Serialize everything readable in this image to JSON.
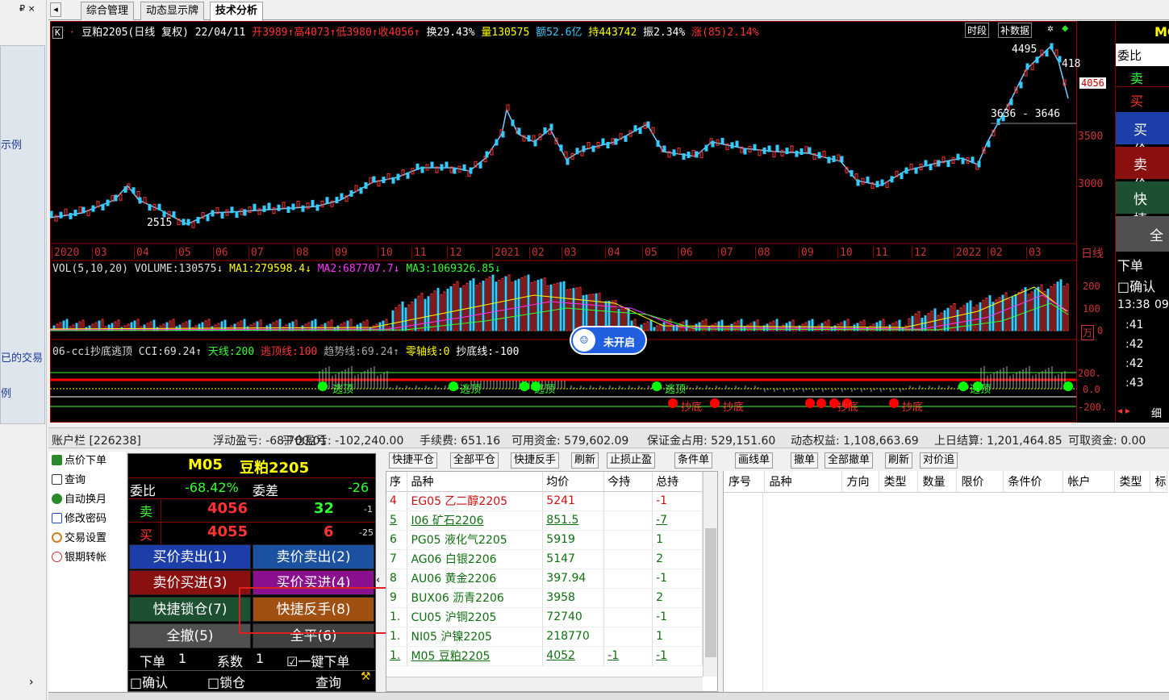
{
  "left_strip": {
    "pin": "₽ ×",
    "links": [
      "示例",
      "已的交易",
      "例"
    ]
  },
  "tabs": [
    "综合管理",
    "动态显示牌",
    "技术分析"
  ],
  "chart": {
    "header": {
      "k_icon": "K",
      "dot": "·",
      "name": "豆粕2205(日线 复权)",
      "date": "22/04/11",
      "open": "开3989↑",
      "high": "高4073↑",
      "low": "低3980↑",
      "close": "收4056↑",
      "turnover": "换29.43%",
      "volume": "量130575",
      "amount": "额52.6亿",
      "oi": "持443742",
      "amp": "振2.34%",
      "chg": "涨(85)2.14%",
      "btn_period": "时段",
      "btn_fill": "补数据"
    },
    "price_labels": {
      "high": "4495",
      "low": "2515",
      "range": "3636 - 3646",
      "partial": "418",
      "current": "4056",
      "axis": [
        "3500",
        "3000"
      ]
    },
    "date_axis": [
      "2020",
      "03",
      "04",
      "05",
      "06",
      "07",
      "08",
      "09",
      "10",
      "11",
      "12",
      "2021",
      "02",
      "03",
      "04",
      "05",
      "06",
      "07",
      "08",
      "09",
      "10",
      "11",
      "12",
      "2022",
      "02",
      "03"
    ],
    "period": "日线",
    "vol": {
      "name": "VOL(5,10,20)",
      "v": "VOLUME:130575↓",
      "ma1": "MA1:279598.4↓",
      "ma2": "MA2:687707.7↓",
      "ma3": "MA3:1069326.85↓",
      "axis": [
        "200",
        "100",
        "0"
      ],
      "unit": "万"
    },
    "cci": {
      "name": "06-cci抄底逃顶",
      "cci": "CCI:69.24↑",
      "sky": "天线:200",
      "top": "逃顶线:100",
      "trend": "趋势线:69.24↑",
      "zero": "零轴线:0",
      "bottom": "抄底线:-100",
      "axis": [
        "200.",
        "0.0",
        "-200."
      ]
    },
    "bottom_labels": [
      "抄底",
      "抄底",
      "抄底",
      "抄底"
    ],
    "top_labels": [
      "逃顶",
      "逃顶",
      "逃顶",
      "逃顶",
      "逃顶"
    ],
    "badge": "未开启"
  },
  "right_panel": {
    "title": "MC",
    "weibi": "委比",
    "sell": "卖",
    "buy": "买",
    "btns": [
      "买价",
      "卖价",
      "快捷",
      "全"
    ],
    "xiadan": "下单",
    "confirm": "□确认",
    "times": [
      "13:38",
      "09",
      ":41",
      ":42",
      ":42",
      ":43"
    ],
    "fine": "细"
  },
  "account": {
    "acct": "账户栏 [226238]",
    "float_pl": "浮动盈亏: -68,700.01",
    "close_pl": "平仓盈亏: -102,240.00",
    "fee": "手续费: 651.16",
    "avail": "可用资金: 579,602.09",
    "margin": "保证金占用: 529,151.60",
    "equity": "动态权益: 1,108,663.69",
    "settle": "上日结算: 1,201,464.85",
    "withdraw": "可取资金: 0.00"
  },
  "menu": [
    "点价下单",
    "查询",
    "自动换月",
    "修改密码",
    "交易设置",
    "银期转帐"
  ],
  "order": {
    "code": "M05",
    "name": "豆粕2205",
    "weibi_l": "委比",
    "weibi_v": "-68.42%",
    "weicha_l": "委差",
    "weicha_v": "-26",
    "sell_l": "卖",
    "sell_p": "4056",
    "sell_q": "32",
    "sell_d": "-1",
    "buy_l": "买",
    "buy_p": "4055",
    "buy_q": "6",
    "buy_d": "-25",
    "btns": [
      "买价卖出(1)",
      "卖价卖出(2)",
      "卖价买进(3)",
      "买价买进(4)",
      "快捷锁仓(7)",
      "快捷反手(8)",
      "全撤(5)",
      "全平(6)"
    ],
    "xiadan": "下单",
    "qty": "1",
    "xishu": "系数",
    "xs": "1",
    "onekey": "☑一键下单",
    "confirm": "□确认",
    "lock": "□锁仓",
    "query": "查询"
  },
  "pos_buttons": [
    "快捷平仓",
    "全部平仓",
    "快捷反手",
    "刷新",
    "止损止盈"
  ],
  "pos_header": [
    "序",
    "品种",
    "均价",
    "今持",
    "总持"
  ],
  "positions": [
    {
      "no": "4",
      "name": "EG05 乙二醇2205",
      "avg": "5241",
      "today": "",
      "total": "-1"
    },
    {
      "no": "5",
      "name": "I06 矿石2206",
      "avg": "851.5",
      "today": "",
      "total": "-7"
    },
    {
      "no": "6",
      "name": "PG05 液化气2205",
      "avg": "5919",
      "today": "",
      "total": "1"
    },
    {
      "no": "7",
      "name": "AG06 白银2206",
      "avg": "5147",
      "today": "",
      "total": "2"
    },
    {
      "no": "8",
      "name": "AU06 黄金2206",
      "avg": "397.94",
      "today": "",
      "total": "-1"
    },
    {
      "no": "9",
      "name": "BUX06 沥青2206",
      "avg": "3958",
      "today": "",
      "total": "2"
    },
    {
      "no": "1.",
      "name": "CU05 沪铜2205",
      "avg": "72740",
      "today": "",
      "total": "-1"
    },
    {
      "no": "1.",
      "name": "NI05 沪镍2205",
      "avg": "218770",
      "today": "",
      "total": "1"
    },
    {
      "no": "1.",
      "name": "M05 豆粕2205",
      "avg": "4052",
      "today": "-1",
      "total": "-1"
    }
  ],
  "ord_buttons": [
    "条件单",
    "画线单",
    "撤单",
    "全部撤单",
    "刷新",
    "对价追"
  ],
  "ord_header": [
    "序号",
    "品种",
    "方向",
    "类型",
    "数量",
    "限价",
    "条件价",
    "帐户",
    "类型",
    "标"
  ],
  "colors": {
    "up": "#ff3030",
    "down": "#30c0ff",
    "bg": "#000000"
  }
}
